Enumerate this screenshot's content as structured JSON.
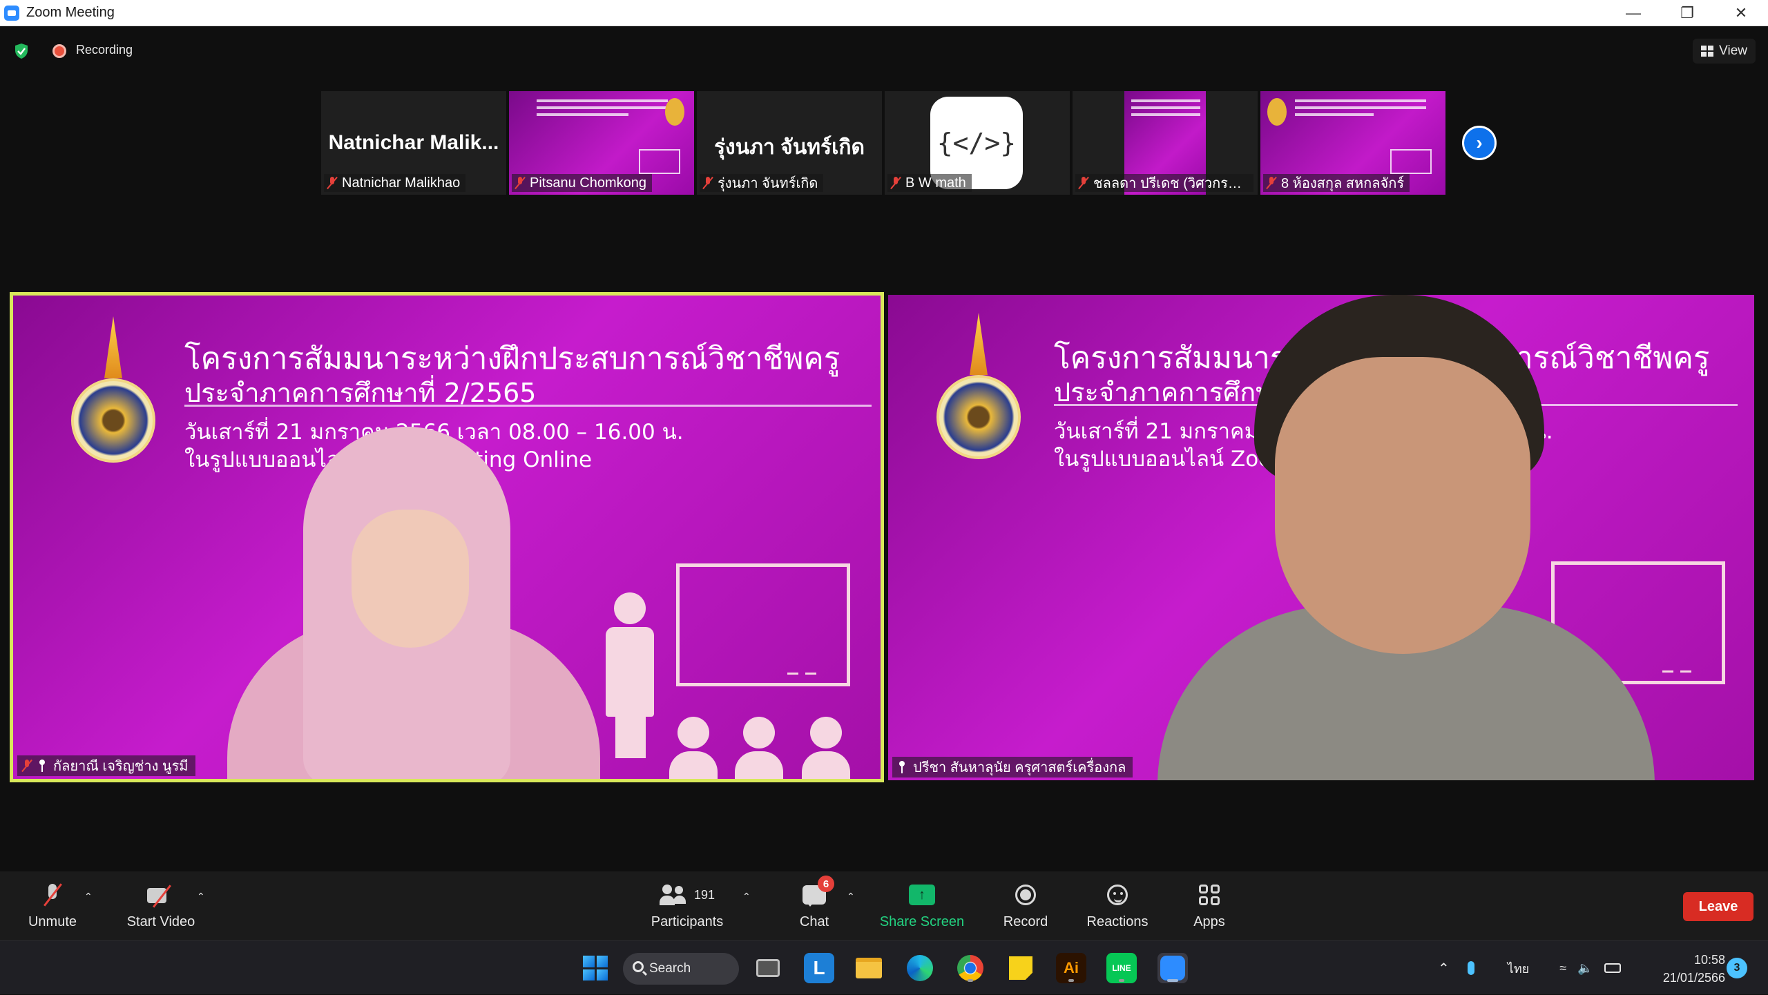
{
  "window": {
    "title": "Zoom Meeting"
  },
  "topbar": {
    "recording_label": "Recording",
    "view_label": "View"
  },
  "thumbnails": [
    {
      "big_name": "Natnichar  Malik...",
      "name": "Natnichar Malikhao"
    },
    {
      "name": "Pitsanu Chomkong"
    },
    {
      "big_name": "รุ่งนภา จันทร์เกิด",
      "name": "รุ่งนภา จันทร์เกิด"
    },
    {
      "name": "B W math",
      "logo_text": "{</>}"
    },
    {
      "name": "ชลลดา ปรีเดช (วิศวกรรม..."
    },
    {
      "name": "8 ห้องสกุล สหกลจักร์"
    }
  ],
  "slide": {
    "line1": "โครงการสัมมนาระหว่างฝึกประสบการณ์วิชาชีพครู",
    "line2": "ประจำภาคการศึกษาที่ 2/2565",
    "line3": "วันเสาร์ที่ 21 มกราคม 2566 เวลา 08.00 – 16.00 น.",
    "line4": "ในรูปแบบออนไลน์ Zoom Meeting Online"
  },
  "main_tiles": [
    {
      "name": "กัลยาณี เจริญช่าง นูรมี",
      "active_speaker": true
    },
    {
      "name": "ปรีชา สันหาลุนัย ครุศาสตร์เครื่องกล",
      "active_speaker": false
    }
  ],
  "controls": {
    "unmute": "Unmute",
    "start_video": "Start Video",
    "participants": "Participants",
    "participants_count": "191",
    "chat": "Chat",
    "chat_badge": "6",
    "share_screen": "Share Screen",
    "record": "Record",
    "reactions": "Reactions",
    "apps": "Apps",
    "leave": "Leave"
  },
  "taskbar": {
    "search_label": "Search",
    "language": "ไทย",
    "time": "10:58",
    "date": "21/01/2566",
    "notification_count": "3",
    "pinned": [
      "windows-start",
      "search",
      "task-view",
      "l-app",
      "file-explorer",
      "edge",
      "chrome",
      "sticky-notes",
      "adobe-illustrator",
      "line",
      "zoom"
    ]
  },
  "colors": {
    "accent_blue": "#0e71eb",
    "active_speaker_border": "#d8e85a",
    "leave_red": "#d82c23",
    "share_green": "#12b76a",
    "slide_magenta": "#c21ac9"
  }
}
